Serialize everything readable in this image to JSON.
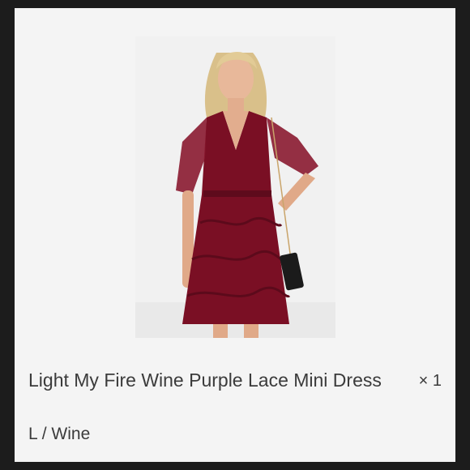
{
  "product": {
    "title": "Light My Fire Wine Purple Lace Mini Dress",
    "variant": "L / Wine",
    "quantity": "× 1",
    "image_description": "model-in-wine-lace-dress"
  },
  "colors": {
    "card_background": "#f4f4f4",
    "frame": "#1c1c1c",
    "text": "#3b3b3b",
    "dress": "#7a0f24"
  }
}
